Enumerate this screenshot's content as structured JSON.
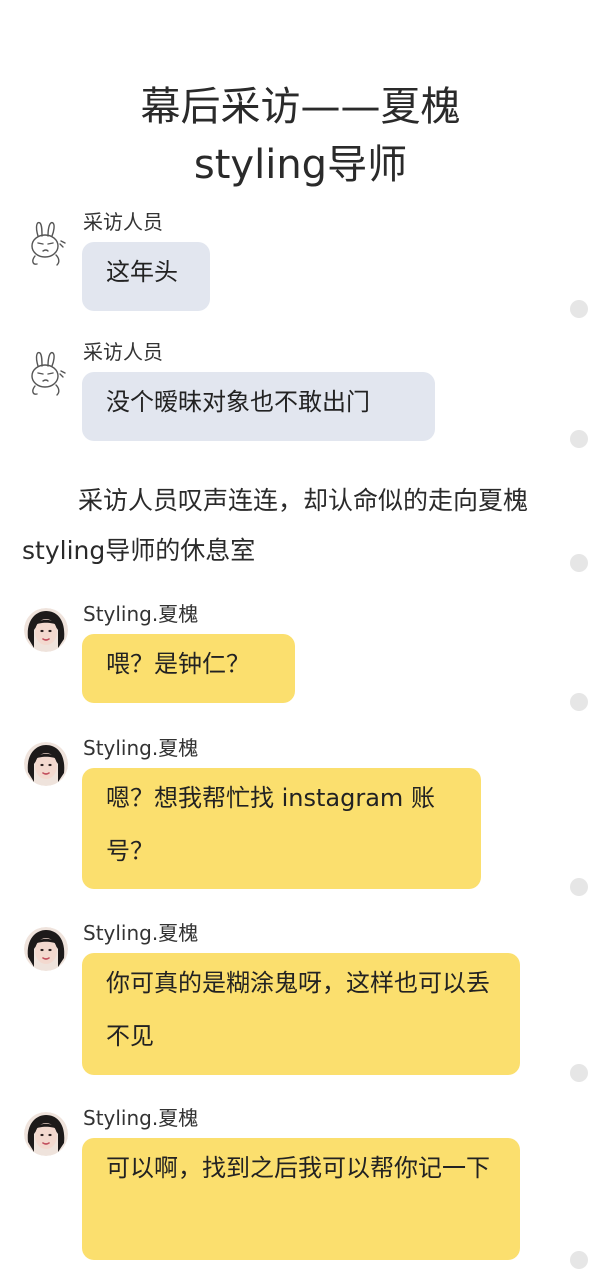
{
  "title": {
    "line1": "幕后采访——夏槐",
    "line2": "styling导师"
  },
  "narration": "采访人员叹声连连，却认命似的走向夏槐 styling导师的休息室",
  "messages": [
    {
      "sender": "采访人员",
      "avatar": "rabbit-avatar",
      "text": "这年头"
    },
    {
      "sender": "采访人员",
      "avatar": "rabbit-avatar",
      "text": "没个暧昧对象也不敢出门"
    },
    {
      "sender": "Styling.夏槐",
      "avatar": "woman-avatar",
      "text": "喂？是钟仁？"
    },
    {
      "sender": "Styling.夏槐",
      "avatar": "woman-avatar",
      "text": "嗯？想我帮忙找 instagram 账号？"
    },
    {
      "sender": "Styling.夏槐",
      "avatar": "woman-avatar",
      "text": "你可真的是糊涂鬼呀，这样也可以丢不见"
    },
    {
      "sender": "Styling.夏槐",
      "avatar": "woman-avatar",
      "text": "可以啊，找到之后我可以帮你记一下"
    }
  ],
  "colors": {
    "interviewer_bubble": "#e2e6ef",
    "stylist_bubble": "#fbdf6e",
    "dot": "#e6e6e6"
  }
}
